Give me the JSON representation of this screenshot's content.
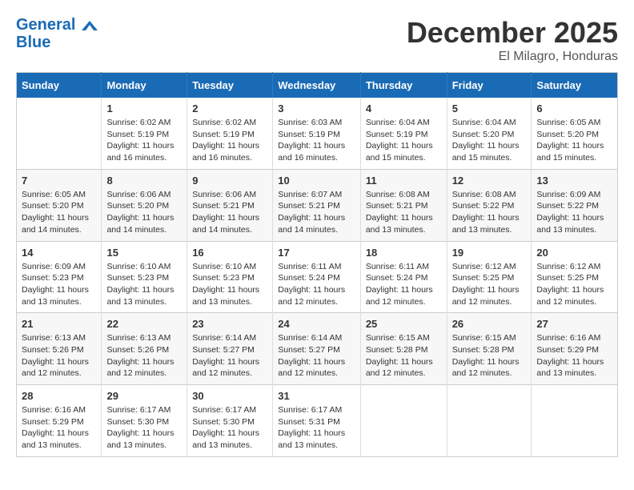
{
  "logo": {
    "line1": "General",
    "line2": "Blue"
  },
  "header": {
    "month": "December 2025",
    "location": "El Milagro, Honduras"
  },
  "weekdays": [
    "Sunday",
    "Monday",
    "Tuesday",
    "Wednesday",
    "Thursday",
    "Friday",
    "Saturday"
  ],
  "weeks": [
    [
      {
        "day": "",
        "sunrise": "",
        "sunset": "",
        "daylight": ""
      },
      {
        "day": "1",
        "sunrise": "Sunrise: 6:02 AM",
        "sunset": "Sunset: 5:19 PM",
        "daylight": "Daylight: 11 hours and 16 minutes."
      },
      {
        "day": "2",
        "sunrise": "Sunrise: 6:02 AM",
        "sunset": "Sunset: 5:19 PM",
        "daylight": "Daylight: 11 hours and 16 minutes."
      },
      {
        "day": "3",
        "sunrise": "Sunrise: 6:03 AM",
        "sunset": "Sunset: 5:19 PM",
        "daylight": "Daylight: 11 hours and 16 minutes."
      },
      {
        "day": "4",
        "sunrise": "Sunrise: 6:04 AM",
        "sunset": "Sunset: 5:19 PM",
        "daylight": "Daylight: 11 hours and 15 minutes."
      },
      {
        "day": "5",
        "sunrise": "Sunrise: 6:04 AM",
        "sunset": "Sunset: 5:20 PM",
        "daylight": "Daylight: 11 hours and 15 minutes."
      },
      {
        "day": "6",
        "sunrise": "Sunrise: 6:05 AM",
        "sunset": "Sunset: 5:20 PM",
        "daylight": "Daylight: 11 hours and 15 minutes."
      }
    ],
    [
      {
        "day": "7",
        "sunrise": "Sunrise: 6:05 AM",
        "sunset": "Sunset: 5:20 PM",
        "daylight": "Daylight: 11 hours and 14 minutes."
      },
      {
        "day": "8",
        "sunrise": "Sunrise: 6:06 AM",
        "sunset": "Sunset: 5:20 PM",
        "daylight": "Daylight: 11 hours and 14 minutes."
      },
      {
        "day": "9",
        "sunrise": "Sunrise: 6:06 AM",
        "sunset": "Sunset: 5:21 PM",
        "daylight": "Daylight: 11 hours and 14 minutes."
      },
      {
        "day": "10",
        "sunrise": "Sunrise: 6:07 AM",
        "sunset": "Sunset: 5:21 PM",
        "daylight": "Daylight: 11 hours and 14 minutes."
      },
      {
        "day": "11",
        "sunrise": "Sunrise: 6:08 AM",
        "sunset": "Sunset: 5:21 PM",
        "daylight": "Daylight: 11 hours and 13 minutes."
      },
      {
        "day": "12",
        "sunrise": "Sunrise: 6:08 AM",
        "sunset": "Sunset: 5:22 PM",
        "daylight": "Daylight: 11 hours and 13 minutes."
      },
      {
        "day": "13",
        "sunrise": "Sunrise: 6:09 AM",
        "sunset": "Sunset: 5:22 PM",
        "daylight": "Daylight: 11 hours and 13 minutes."
      }
    ],
    [
      {
        "day": "14",
        "sunrise": "Sunrise: 6:09 AM",
        "sunset": "Sunset: 5:23 PM",
        "daylight": "Daylight: 11 hours and 13 minutes."
      },
      {
        "day": "15",
        "sunrise": "Sunrise: 6:10 AM",
        "sunset": "Sunset: 5:23 PM",
        "daylight": "Daylight: 11 hours and 13 minutes."
      },
      {
        "day": "16",
        "sunrise": "Sunrise: 6:10 AM",
        "sunset": "Sunset: 5:23 PM",
        "daylight": "Daylight: 11 hours and 13 minutes."
      },
      {
        "day": "17",
        "sunrise": "Sunrise: 6:11 AM",
        "sunset": "Sunset: 5:24 PM",
        "daylight": "Daylight: 11 hours and 12 minutes."
      },
      {
        "day": "18",
        "sunrise": "Sunrise: 6:11 AM",
        "sunset": "Sunset: 5:24 PM",
        "daylight": "Daylight: 11 hours and 12 minutes."
      },
      {
        "day": "19",
        "sunrise": "Sunrise: 6:12 AM",
        "sunset": "Sunset: 5:25 PM",
        "daylight": "Daylight: 11 hours and 12 minutes."
      },
      {
        "day": "20",
        "sunrise": "Sunrise: 6:12 AM",
        "sunset": "Sunset: 5:25 PM",
        "daylight": "Daylight: 11 hours and 12 minutes."
      }
    ],
    [
      {
        "day": "21",
        "sunrise": "Sunrise: 6:13 AM",
        "sunset": "Sunset: 5:26 PM",
        "daylight": "Daylight: 11 hours and 12 minutes."
      },
      {
        "day": "22",
        "sunrise": "Sunrise: 6:13 AM",
        "sunset": "Sunset: 5:26 PM",
        "daylight": "Daylight: 11 hours and 12 minutes."
      },
      {
        "day": "23",
        "sunrise": "Sunrise: 6:14 AM",
        "sunset": "Sunset: 5:27 PM",
        "daylight": "Daylight: 11 hours and 12 minutes."
      },
      {
        "day": "24",
        "sunrise": "Sunrise: 6:14 AM",
        "sunset": "Sunset: 5:27 PM",
        "daylight": "Daylight: 11 hours and 12 minutes."
      },
      {
        "day": "25",
        "sunrise": "Sunrise: 6:15 AM",
        "sunset": "Sunset: 5:28 PM",
        "daylight": "Daylight: 11 hours and 12 minutes."
      },
      {
        "day": "26",
        "sunrise": "Sunrise: 6:15 AM",
        "sunset": "Sunset: 5:28 PM",
        "daylight": "Daylight: 11 hours and 12 minutes."
      },
      {
        "day": "27",
        "sunrise": "Sunrise: 6:16 AM",
        "sunset": "Sunset: 5:29 PM",
        "daylight": "Daylight: 11 hours and 13 minutes."
      }
    ],
    [
      {
        "day": "28",
        "sunrise": "Sunrise: 6:16 AM",
        "sunset": "Sunset: 5:29 PM",
        "daylight": "Daylight: 11 hours and 13 minutes."
      },
      {
        "day": "29",
        "sunrise": "Sunrise: 6:17 AM",
        "sunset": "Sunset: 5:30 PM",
        "daylight": "Daylight: 11 hours and 13 minutes."
      },
      {
        "day": "30",
        "sunrise": "Sunrise: 6:17 AM",
        "sunset": "Sunset: 5:30 PM",
        "daylight": "Daylight: 11 hours and 13 minutes."
      },
      {
        "day": "31",
        "sunrise": "Sunrise: 6:17 AM",
        "sunset": "Sunset: 5:31 PM",
        "daylight": "Daylight: 11 hours and 13 minutes."
      },
      {
        "day": "",
        "sunrise": "",
        "sunset": "",
        "daylight": ""
      },
      {
        "day": "",
        "sunrise": "",
        "sunset": "",
        "daylight": ""
      },
      {
        "day": "",
        "sunrise": "",
        "sunset": "",
        "daylight": ""
      }
    ]
  ]
}
